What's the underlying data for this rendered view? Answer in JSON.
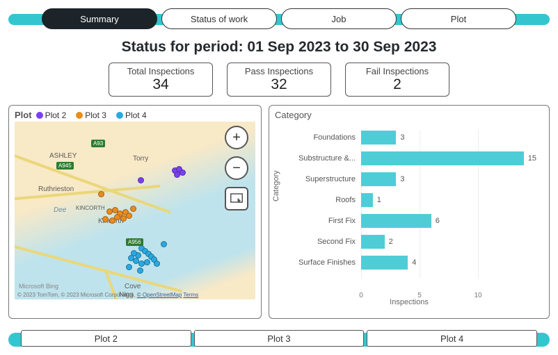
{
  "tabs": [
    {
      "label": "Summary",
      "active": true
    },
    {
      "label": "Status of work",
      "active": false
    },
    {
      "label": "Job",
      "active": false
    },
    {
      "label": "Plot",
      "active": false
    }
  ],
  "title": "Status for period: 01 Sep 2023 to 30 Sep 2023",
  "stats": {
    "total": {
      "label": "Total Inspections",
      "value": "34"
    },
    "pass": {
      "label": "Pass Inspections",
      "value": "32"
    },
    "fail": {
      "label": "Fail Inspections",
      "value": "2"
    }
  },
  "map": {
    "title": "Plot",
    "legend": [
      {
        "label": "Plot 2",
        "color": "#7b3ff2"
      },
      {
        "label": "Plot 3",
        "color": "#e88c1f"
      },
      {
        "label": "Plot 4",
        "color": "#2aa9e0"
      }
    ],
    "road_badges": [
      "A93",
      "A945",
      "A956"
    ],
    "city_labels": [
      "ASHLEY",
      "Torry",
      "Ruthrieston",
      "KINCORTH",
      "Kincorth",
      "Dee",
      "Nigg",
      "Cove"
    ],
    "attribution_prefix": "© 2023 TomTom, © 2023 Microsoft Corporation, ",
    "attribution_osm": "© OpenStreetMap",
    "attribution_terms": "Terms",
    "ms_bing": "Microsoft Bing",
    "controls": {
      "zoom_in": "+",
      "zoom_out": "−"
    },
    "points": {
      "plot2": [
        {
          "x": 226,
          "y": 66
        },
        {
          "x": 232,
          "y": 64
        },
        {
          "x": 237,
          "y": 69
        },
        {
          "x": 229,
          "y": 72
        },
        {
          "x": 177,
          "y": 80
        }
      ],
      "plot3": [
        {
          "x": 120,
          "y": 100
        },
        {
          "x": 132,
          "y": 125
        },
        {
          "x": 140,
          "y": 123
        },
        {
          "x": 147,
          "y": 128
        },
        {
          "x": 155,
          "y": 126
        },
        {
          "x": 160,
          "y": 131
        },
        {
          "x": 152,
          "y": 135
        },
        {
          "x": 143,
          "y": 133
        },
        {
          "x": 136,
          "y": 138
        },
        {
          "x": 126,
          "y": 136
        },
        {
          "x": 166,
          "y": 121
        }
      ],
      "plot4": [
        {
          "x": 178,
          "y": 178
        },
        {
          "x": 183,
          "y": 182
        },
        {
          "x": 188,
          "y": 186
        },
        {
          "x": 192,
          "y": 190
        },
        {
          "x": 196,
          "y": 194
        },
        {
          "x": 200,
          "y": 200
        },
        {
          "x": 186,
          "y": 198
        },
        {
          "x": 178,
          "y": 200
        },
        {
          "x": 170,
          "y": 196
        },
        {
          "x": 163,
          "y": 192
        },
        {
          "x": 173,
          "y": 188
        },
        {
          "x": 167,
          "y": 185
        },
        {
          "x": 210,
          "y": 172
        },
        {
          "x": 160,
          "y": 205
        },
        {
          "x": 176,
          "y": 210
        }
      ]
    }
  },
  "chart": {
    "title": "Category",
    "xlabel": "Inspections",
    "ylabel": "Category",
    "x_ticks": [
      {
        "label": "0",
        "pos": 0
      },
      {
        "label": "5",
        "pos": 5
      },
      {
        "label": "10",
        "pos": 10
      }
    ]
  },
  "chart_data": {
    "type": "bar",
    "orientation": "horizontal",
    "categories": [
      "Foundations",
      "Substructure &...",
      "Superstructure",
      "Roofs",
      "First Fix",
      "Second Fix",
      "Surface Finishes"
    ],
    "values": [
      3,
      15,
      3,
      1,
      6,
      2,
      4
    ],
    "title": "Category",
    "xlabel": "Inspections",
    "ylabel": "Category",
    "xlim": [
      0,
      15
    ]
  },
  "plot_buttons": [
    "Plot 2",
    "Plot 3",
    "Plot 4"
  ]
}
